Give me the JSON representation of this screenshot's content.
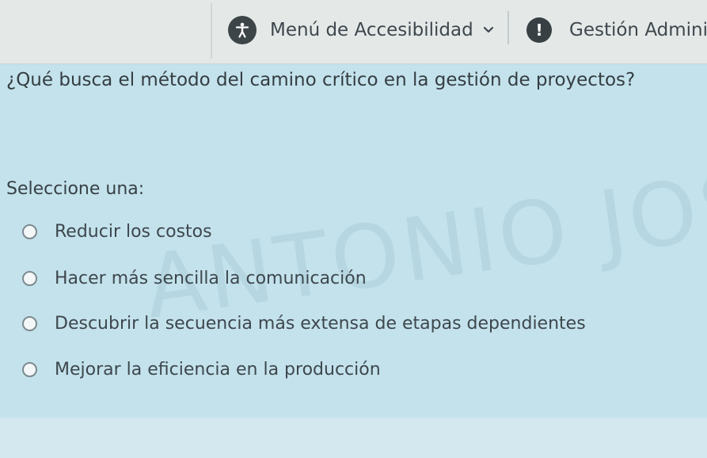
{
  "toolbar": {
    "accessibility_menu_label": "Menú de Accesibilidad",
    "admin_menu_label": "Gestión Admini"
  },
  "quiz": {
    "question": "¿Qué busca el método del camino crítico en la gestión de proyectos?",
    "prompt": "Seleccione una:",
    "options": [
      {
        "label": "Reducir los costos",
        "selected": false
      },
      {
        "label": "Hacer más sencilla la comunicación",
        "selected": false
      },
      {
        "label": "Descubrir la secuencia más extensa de etapas dependientes",
        "selected": false
      },
      {
        "label": "Mejorar la eficiencia en la producción",
        "selected": false
      }
    ]
  },
  "watermark": "ANTONIO JOSE",
  "colors": {
    "panel_bg": "#c3e2ec",
    "toolbar_bg": "#e4e9e8",
    "icon_dark": "#3e4549"
  },
  "icons": [
    "accessibility-icon",
    "chevron-down-icon",
    "alert-icon",
    "radio-icon"
  ]
}
